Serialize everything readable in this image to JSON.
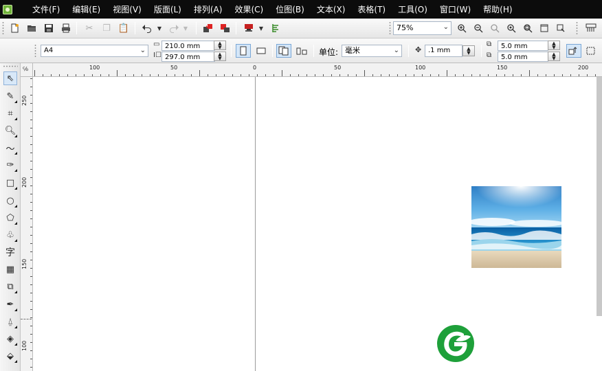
{
  "menubar": {
    "items": [
      "文件(F)",
      "编辑(E)",
      "视图(V)",
      "版面(L)",
      "排列(A)",
      "效果(C)",
      "位图(B)",
      "文本(X)",
      "表格(T)",
      "工具(O)",
      "窗口(W)",
      "帮助(H)"
    ]
  },
  "toolbar": {
    "zoom_value": "75%"
  },
  "property_bar": {
    "paper_size": "A4",
    "width": "210.0 mm",
    "height": "297.0 mm",
    "unit_label": "单位:",
    "unit_value": "毫米",
    "nudge": ".1 mm",
    "dup_x": "5.0 mm",
    "dup_y": "5.0 mm"
  },
  "ruler_h": {
    "labels": [
      "100",
      "50",
      "0",
      "50",
      "100",
      "150",
      "200"
    ]
  },
  "ruler_v": {
    "labels": [
      "250",
      "200",
      "150",
      "100"
    ]
  },
  "ruler_corner": "℅",
  "colors": {
    "menubar_bg": "#0c0c0c",
    "logo_green": "#1ea03a",
    "accent_blue": "#7aa7d6"
  },
  "tool_icons": [
    "pick-tool-icon",
    "shape-tool-icon",
    "crop-tool-icon",
    "zoom-tool-icon",
    "freehand-tool-icon",
    "smart-fill-tool-icon",
    "rectangle-tool-icon",
    "ellipse-tool-icon",
    "polygon-tool-icon",
    "basic-shapes-tool-icon",
    "text-tool-icon",
    "table-tool-icon",
    "interactive-blend-tool-icon",
    "eyedropper-tool-icon",
    "outline-tool-icon",
    "fill-tool-icon",
    "interactive-fill-tool-icon"
  ],
  "text_tool_glyph": "字"
}
